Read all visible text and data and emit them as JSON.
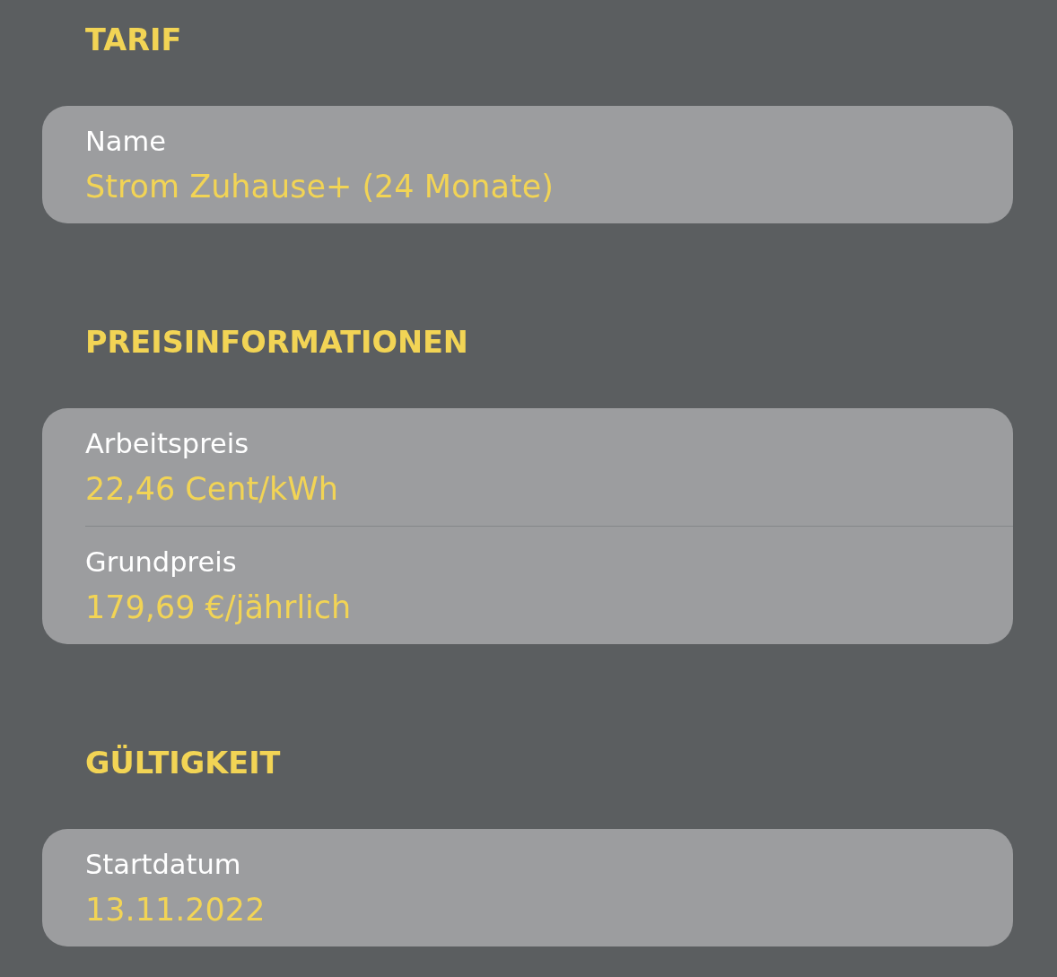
{
  "sections": [
    {
      "title": "TARIF",
      "fields": [
        {
          "label": "Name",
          "value": "Strom Zuhause+ (24 Monate)"
        }
      ]
    },
    {
      "title": "PREISINFORMATIONEN",
      "fields": [
        {
          "label": "Arbeitspreis",
          "value": "22,46 Cent/kWh"
        },
        {
          "label": "Grundpreis",
          "value": "179,69 €/jährlich"
        }
      ]
    },
    {
      "title": "GÜLTIGKEIT",
      "fields": [
        {
          "label": "Startdatum",
          "value": "13.11.2022"
        }
      ]
    }
  ]
}
